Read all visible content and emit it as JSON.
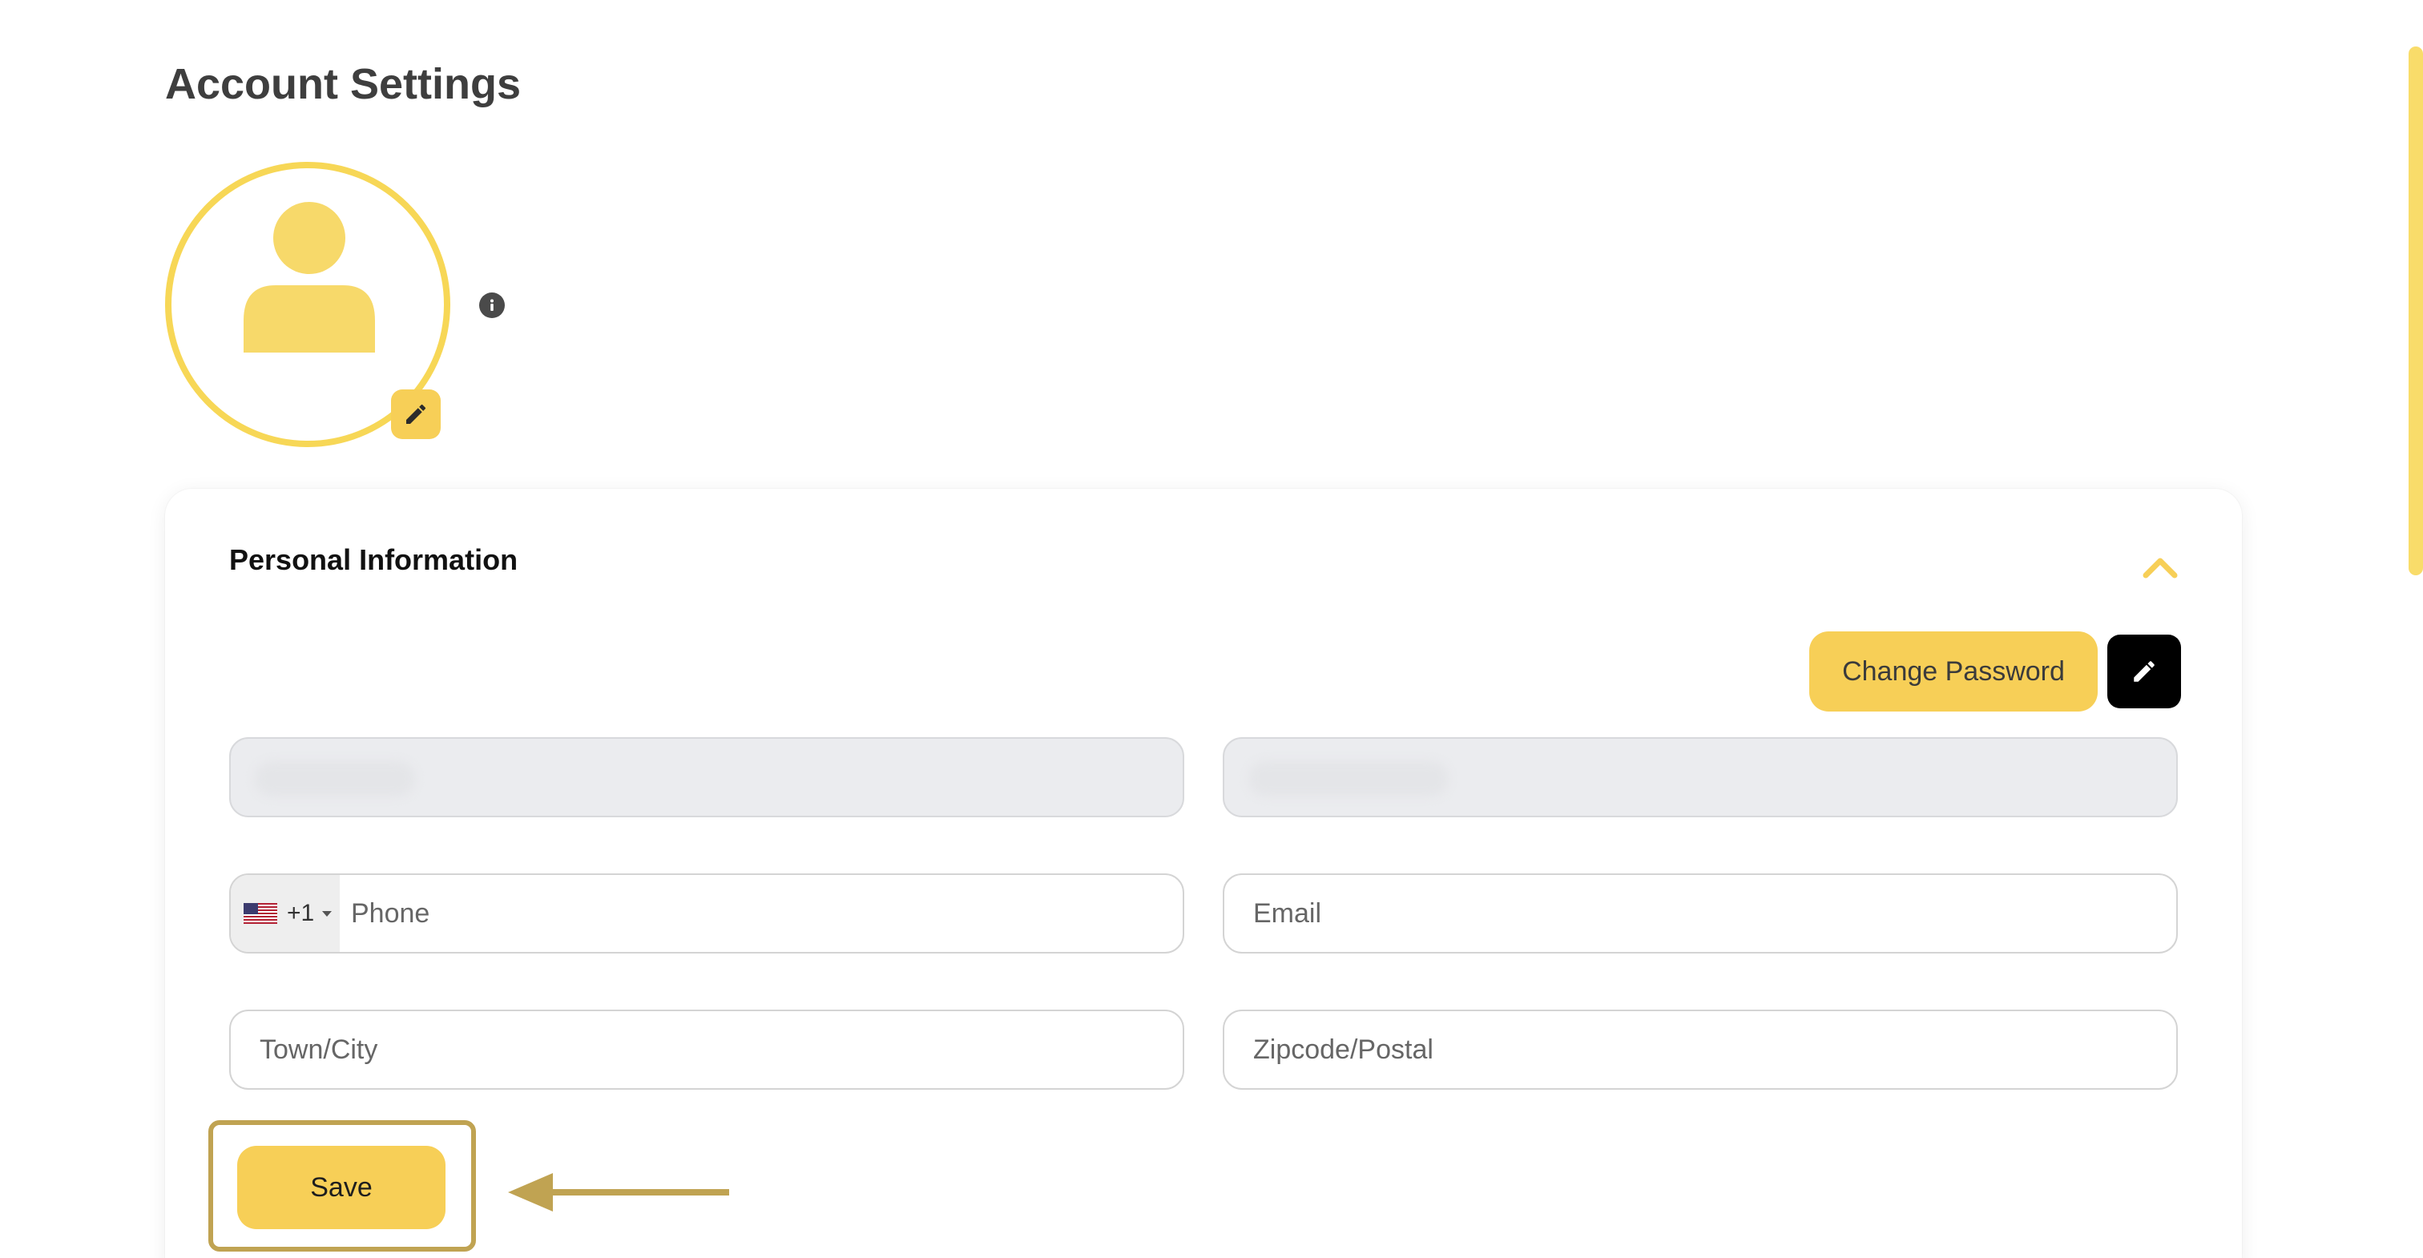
{
  "page": {
    "title": "Account Settings"
  },
  "avatar": {
    "icon": "user-icon",
    "edit_icon": "pencil-icon",
    "info_icon": "info-icon"
  },
  "personal_info": {
    "title": "Personal Information",
    "toggle_icon": "chevron-up-icon",
    "change_password_label": "Change Password",
    "edit_icon": "pencil-icon",
    "fields": {
      "first_name": {
        "value": ""
      },
      "last_name": {
        "value": ""
      },
      "phone": {
        "country_flag": "us-flag-icon",
        "dial_code": "+1",
        "placeholder": "Phone",
        "value": ""
      },
      "email": {
        "placeholder": "Email",
        "value": ""
      },
      "town_city": {
        "placeholder": "Town/City",
        "value": ""
      },
      "zipcode": {
        "placeholder": "Zipcode/Postal",
        "value": ""
      }
    },
    "save_label": "Save"
  },
  "colors": {
    "accent": "#f7cf57",
    "avatar_ring": "#f7d756",
    "annotation": "#c0a352",
    "dark_button": "#000000"
  }
}
